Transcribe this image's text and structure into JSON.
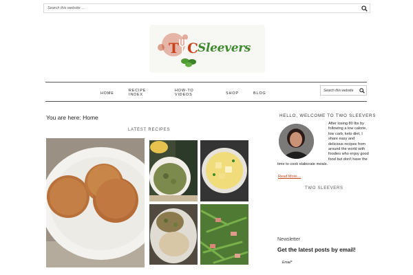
{
  "header": {
    "search_placeholder": "Search this website …",
    "logo_letter_t": "T",
    "logo_letter_c": "C",
    "logo_word": "Sleevers"
  },
  "nav": {
    "items": [
      {
        "label": "HOME"
      },
      {
        "label": "RECIPE INDEX"
      },
      {
        "label": "HOW-TO VIDEOS"
      },
      {
        "label": "SHOP"
      },
      {
        "label": "BLOG"
      }
    ],
    "search_placeholder": "Search this website"
  },
  "main": {
    "breadcrumb": "You are here: Home",
    "latest_heading": "LATEST RECIPES"
  },
  "sidebar": {
    "welcome_title": "HELLO, WELCOME TO TWO SLEEVERS",
    "bio": "After losing 80 lbs by following a low calorie, low carb, keto diet, I share easy and delicious recipes from around the world with foodies who enjoy good food but don't have the time to cook elaborate meals.",
    "read_more": "Read More…",
    "two_sleevers_heading": "TWO SLEEVERS",
    "newsletter_label": "Newsletter",
    "latest_posts_heading": "Get the latest posts by email!",
    "email_label": "Email*"
  },
  "colors": {
    "accent_red": "#c9421c",
    "logo_green": "#3f8a2e",
    "rule": "#555555"
  }
}
